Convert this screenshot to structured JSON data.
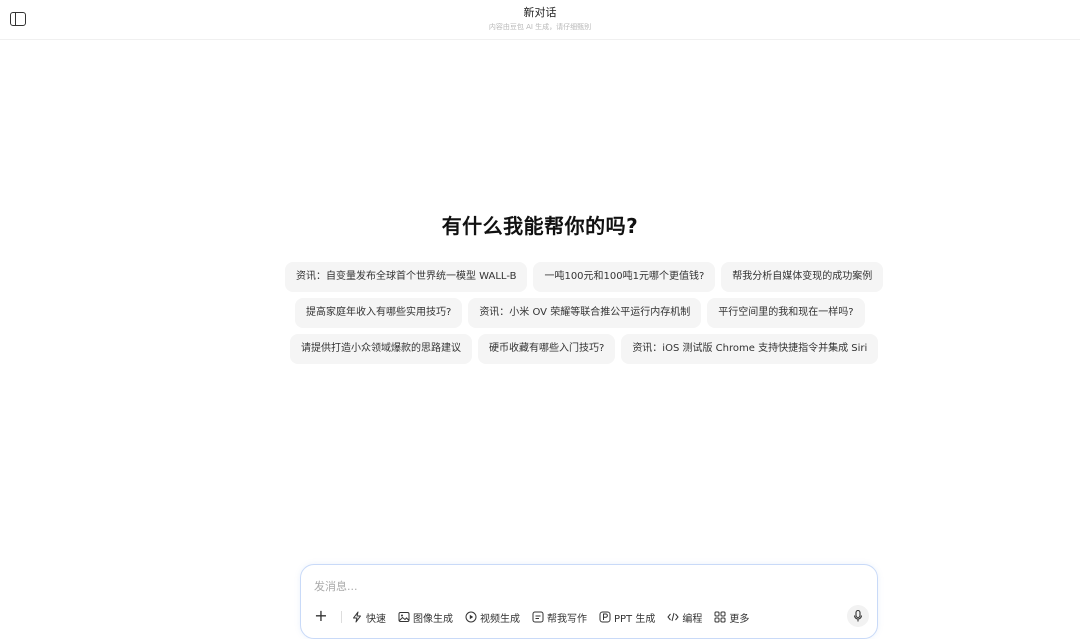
{
  "header": {
    "title": "新对话",
    "subtitle": "内容由豆包 AI 生成，请仔细甄别"
  },
  "main": {
    "heading": "有什么我能帮你的吗?",
    "suggestions": [
      [
        "资讯：自变量发布全球首个世界统一模型 WALL-B",
        "一吨100元和100吨1元哪个更值钱?",
        "帮我分析自媒体变现的成功案例"
      ],
      [
        "提高家庭年收入有哪些实用技巧?",
        "资讯：小米 OV 荣耀等联合推公平运行内存机制",
        "平行空间里的我和现在一样吗?"
      ],
      [
        "请提供打造小众领域爆款的思路建议",
        "硬币收藏有哪些入门技巧?",
        "资讯：iOS 测试版 Chrome 支持快捷指令并集成 Siri"
      ]
    ]
  },
  "composer": {
    "placeholder": "发消息...",
    "tools": {
      "quick": "快速",
      "image": "图像生成",
      "video": "视频生成",
      "write": "帮我写作",
      "ppt": "PPT 生成",
      "code": "编程",
      "more": "更多"
    }
  },
  "colors": {
    "composer_border": "#c9daf8",
    "chip_bg": "#f5f5f5"
  }
}
